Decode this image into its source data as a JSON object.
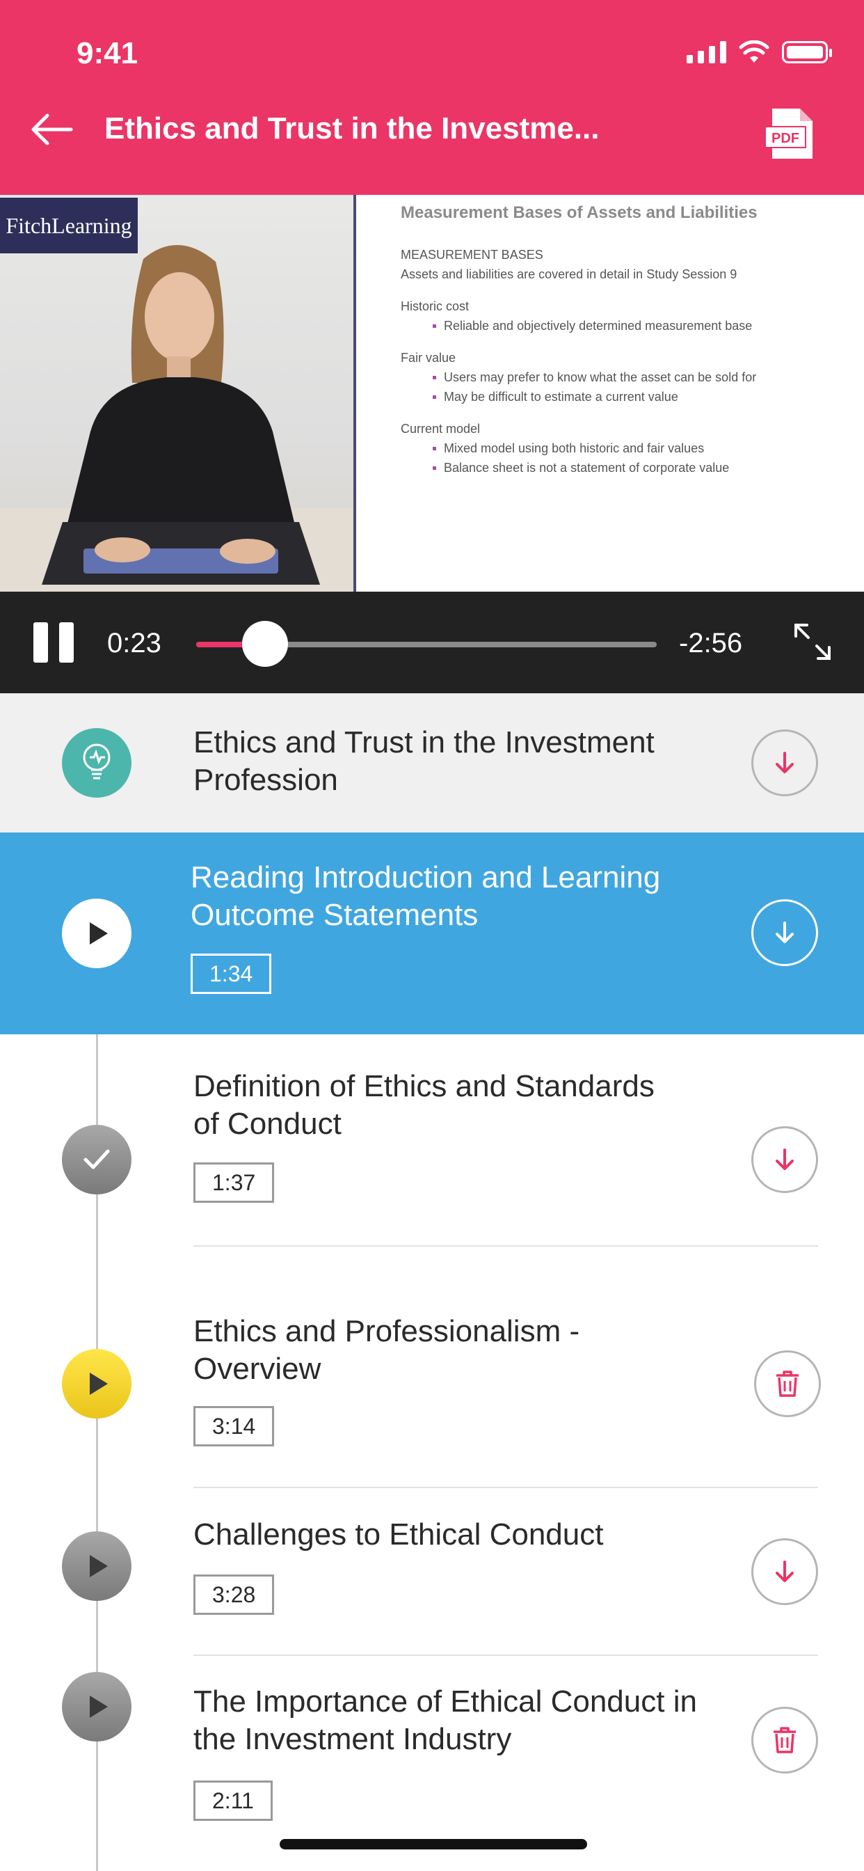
{
  "status_bar": {
    "time": "9:41"
  },
  "header": {
    "title": "Ethics and Trust in the Investme...",
    "pdf_label": "PDF"
  },
  "video": {
    "brand": "FitchLearning",
    "slide": {
      "title": "Measurement Bases of Assets and Liabilities",
      "heading": "MEASUREMENT BASES",
      "intro": "Assets and liabilities are covered in detail in Study Session 9",
      "historic_cost_label": "Historic cost",
      "historic_cost_bullets": [
        "Reliable and objectively determined measurement base"
      ],
      "fair_value_label": "Fair value",
      "fair_value_bullets": [
        "Users may prefer to know what the asset can be sold for",
        "May be difficult to estimate a current value"
      ],
      "current_model_label": "Current model",
      "current_model_bullets": [
        "Mixed model using both historic and fair values",
        "Balance sheet is not a statement of corporate value"
      ]
    }
  },
  "player": {
    "elapsed": "0:23",
    "remaining": "-2:56",
    "progress": 0.15
  },
  "lessons": [
    {
      "title_line1": "Ethics and Trust in the Investment",
      "title_line2": "Profession",
      "state": "intro",
      "action": "download"
    },
    {
      "title_line1": "Reading Introduction and Learning",
      "title_line2": "Outcome Statements",
      "duration": "1:34",
      "state": "playing",
      "action": "download"
    },
    {
      "title_line1": "Definition of Ethics and Standards",
      "title_line2": "of Conduct",
      "duration": "1:37",
      "state": "completed",
      "action": "download"
    },
    {
      "title_line1": "Ethics and Professionalism -",
      "title_line2": "Overview",
      "duration": "3:14",
      "state": "in-progress",
      "action": "delete"
    },
    {
      "title_line1": "Challenges to Ethical Conduct",
      "duration": "3:28",
      "state": "not-started",
      "action": "download"
    },
    {
      "title_line1": "The Importance of Ethical Conduct in",
      "title_line2": "the Investment Industry",
      "duration": "2:11",
      "state": "not-started",
      "action": "delete"
    }
  ],
  "colors": {
    "brand_pink": "#ea3566",
    "active_blue": "#40a6e0",
    "in_progress_yellow": "#f0d31e",
    "intro_teal": "#4db6ac"
  }
}
